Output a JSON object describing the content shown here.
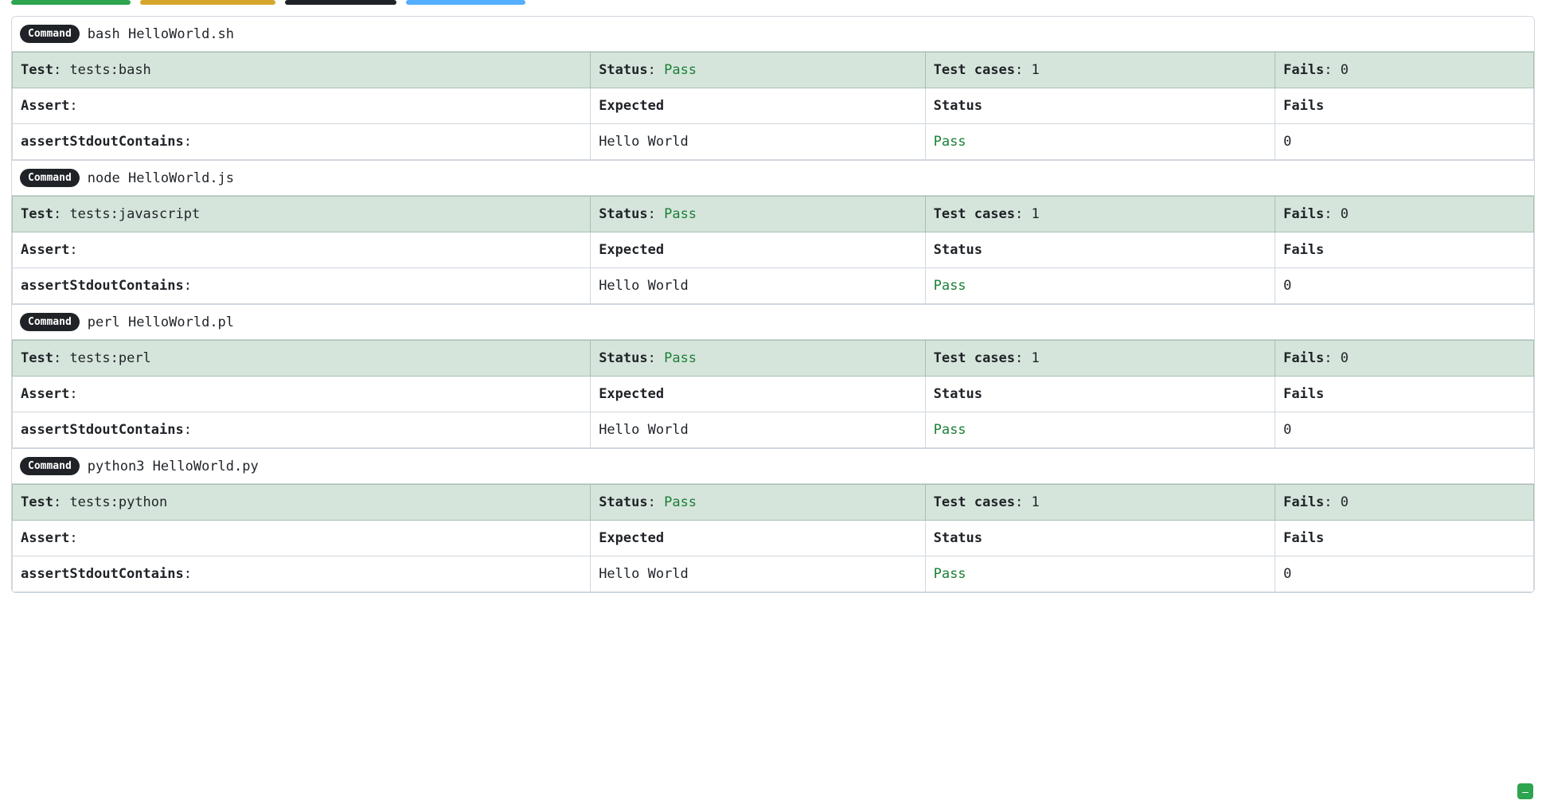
{
  "labels": {
    "command_badge": "Command",
    "test": "Test",
    "status": "Status",
    "test_cases": "Test cases",
    "fails": "Fails",
    "assert": "Assert",
    "expected": "Expected",
    "fails_header": "Fails",
    "status_header": "Status",
    "pass": "Pass"
  },
  "blocks": [
    {
      "command": "bash HelloWorld.sh",
      "test_name": "tests:bash",
      "status": "Pass",
      "test_cases": "1",
      "fails": "0",
      "rows": [
        {
          "assert": "assertStdoutContains",
          "expected": "Hello World",
          "status": "Pass",
          "fails": "0"
        }
      ]
    },
    {
      "command": "node HelloWorld.js",
      "test_name": "tests:javascript",
      "status": "Pass",
      "test_cases": "1",
      "fails": "0",
      "rows": [
        {
          "assert": "assertStdoutContains",
          "expected": "Hello World",
          "status": "Pass",
          "fails": "0"
        }
      ]
    },
    {
      "command": "perl HelloWorld.pl",
      "test_name": "tests:perl",
      "status": "Pass",
      "test_cases": "1",
      "fails": "0",
      "rows": [
        {
          "assert": "assertStdoutContains",
          "expected": "Hello World",
          "status": "Pass",
          "fails": "0"
        }
      ]
    },
    {
      "command": "python3 HelloWorld.py",
      "test_name": "tests:python",
      "status": "Pass",
      "test_cases": "1",
      "fails": "0",
      "rows": [
        {
          "assert": "assertStdoutContains",
          "expected": "Hello World",
          "status": "Pass",
          "fails": "0"
        }
      ]
    }
  ],
  "fab": "–"
}
